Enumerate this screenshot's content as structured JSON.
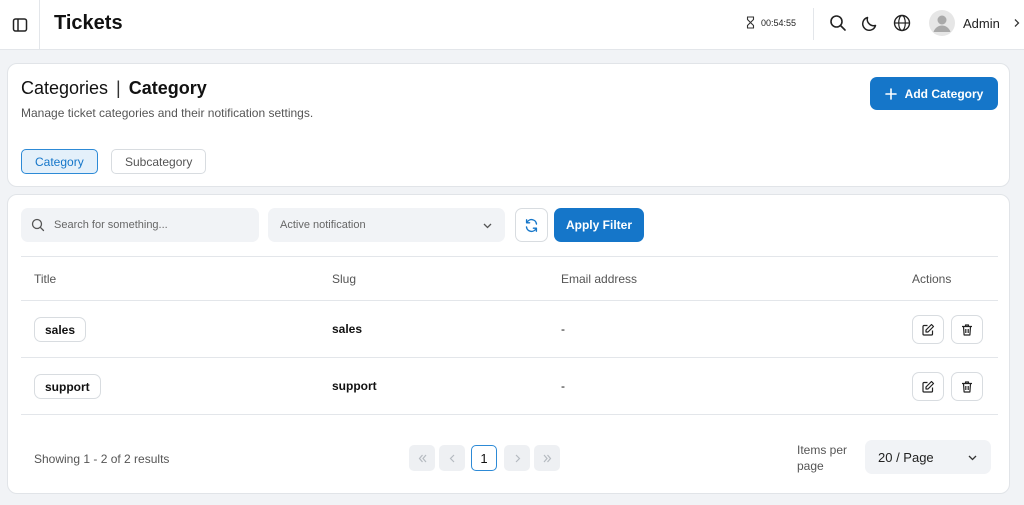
{
  "topbar": {
    "title": "Tickets",
    "timer": "00:54:55",
    "user_name": "Admin",
    "icons": [
      "sidebar-icon",
      "hourglass-icon",
      "search-icon",
      "moon-icon",
      "globe-icon",
      "chevron-right-icon"
    ]
  },
  "header": {
    "breadcrumb_root": "Categories",
    "breadcrumb_sep": "|",
    "breadcrumb_current": "Category",
    "subtitle": "Manage ticket categories and their notification settings.",
    "add_button": "Add Category",
    "tabs": [
      {
        "label": "Category",
        "active": true
      },
      {
        "label": "Subcategory",
        "active": false
      }
    ]
  },
  "filters": {
    "search_placeholder": "Search for something...",
    "notification_select": "Active notification",
    "apply_button": "Apply Filter"
  },
  "table": {
    "columns": [
      "Title",
      "Slug",
      "Email address",
      "Actions"
    ],
    "rows": [
      {
        "title": "sales",
        "slug": "sales",
        "email": "-"
      },
      {
        "title": "support",
        "slug": "support",
        "email": "-"
      }
    ]
  },
  "footer": {
    "showing": "Showing 1 - 2 of 2 results",
    "current_page": "1",
    "items_per_page_label": "Items per page",
    "items_per_page_value": "20 / Page"
  },
  "colors": {
    "primary": "#1576c9",
    "background": "#f1f3f6"
  }
}
